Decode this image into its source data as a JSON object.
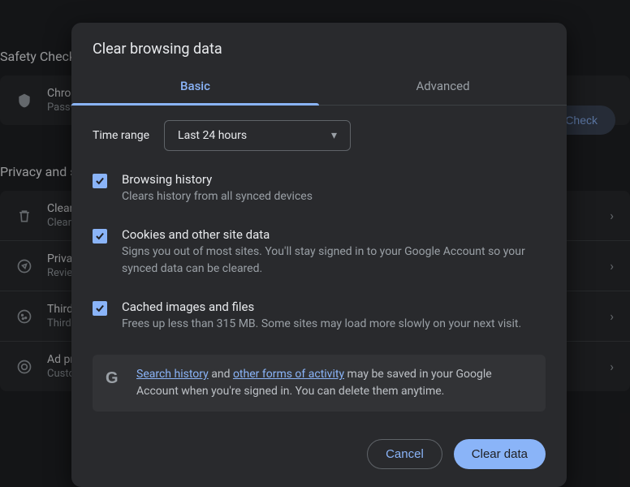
{
  "background": {
    "section_safety": "Safety Check",
    "chrome_title": "Chrome",
    "chrome_sub": "Passwords",
    "safety_button": "Safety Check",
    "section_privacy": "Privacy and security",
    "rows": [
      {
        "title": "Clear browsing data",
        "sub": "Clear history, cookies, cache, and more"
      },
      {
        "title": "Privacy Guide",
        "sub": "Review key privacy and security controls"
      },
      {
        "title": "Third-party cookies",
        "sub": "Third-party cookies are blocked"
      },
      {
        "title": "Ad privacy",
        "sub": "Customize the info used by sites to show you ads"
      }
    ]
  },
  "dialog": {
    "title": "Clear browsing data",
    "tabs": {
      "basic": "Basic",
      "advanced": "Advanced"
    },
    "time_range_label": "Time range",
    "time_range_value": "Last 24 hours",
    "options": [
      {
        "title": "Browsing history",
        "desc": "Clears history from all synced devices",
        "checked": true
      },
      {
        "title": "Cookies and other site data",
        "desc": "Signs you out of most sites. You'll stay signed in to your Google Account so your synced data can be cleared.",
        "checked": true
      },
      {
        "title": "Cached images and files",
        "desc": "Frees up less than 315 MB. Some sites may load more slowly on your next visit.",
        "checked": true
      }
    ],
    "note": {
      "link1": "Search history",
      "mid1": " and ",
      "link2": "other forms of activity",
      "tail": " may be saved in your Google Account when you're signed in. You can delete them anytime."
    },
    "buttons": {
      "cancel": "Cancel",
      "clear": "Clear data"
    }
  }
}
